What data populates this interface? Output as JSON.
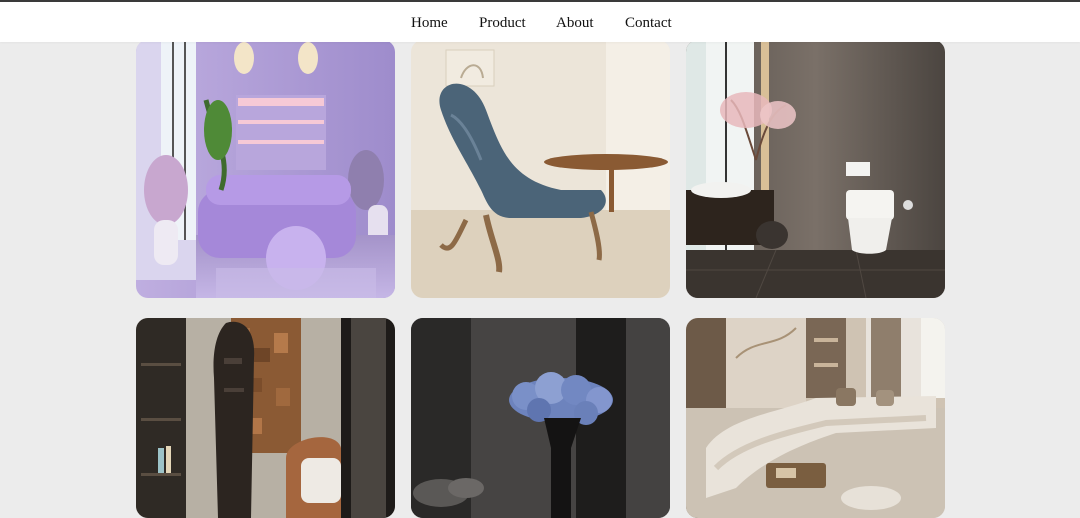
{
  "nav": {
    "items": [
      {
        "label": "Home"
      },
      {
        "label": "Product"
      },
      {
        "label": "About"
      },
      {
        "label": "Contact"
      }
    ]
  },
  "gallery": {
    "images": [
      {
        "subject": "purple-living-room"
      },
      {
        "subject": "blue-sculptural-chair"
      },
      {
        "subject": "modern-bathroom"
      },
      {
        "subject": "tribal-sculpture-room"
      },
      {
        "subject": "blue-flower-vase"
      },
      {
        "subject": "sectional-sofa-lounge"
      }
    ]
  },
  "colors": {
    "background": "#ececec",
    "nav_background": "#ffffff",
    "nav_text": "#111111"
  }
}
